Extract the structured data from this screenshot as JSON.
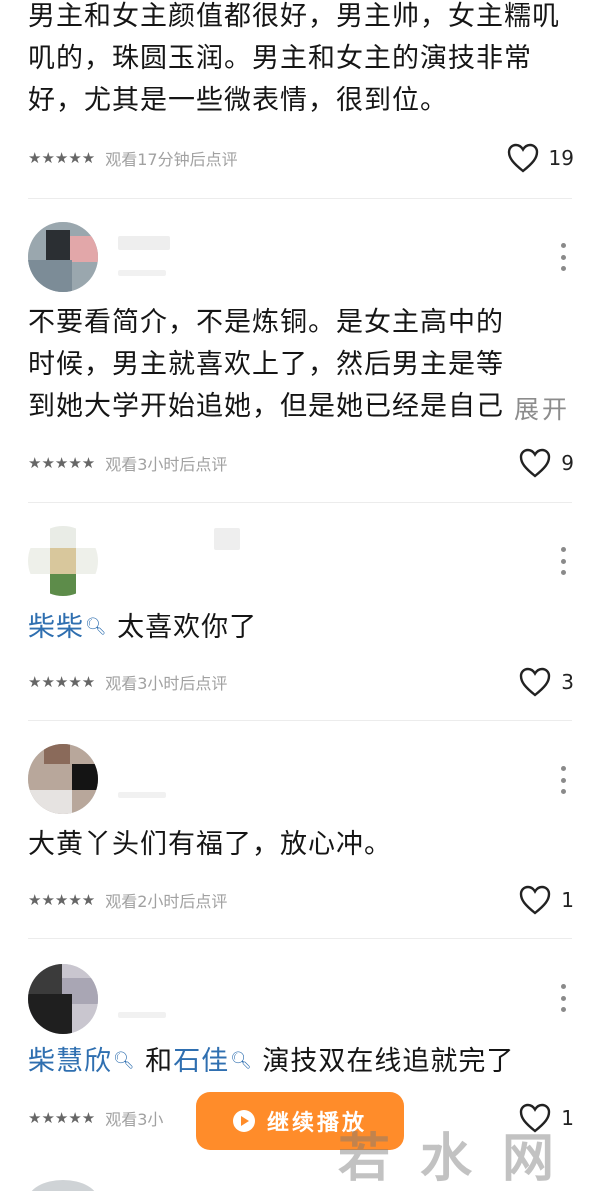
{
  "comments": [
    {
      "text": "男主和女主颜值都很好，男主帅，女主糯叽叽的，珠圆玉润。男主和女主的演技非常好，尤其是一些微表情，很到位。",
      "stars": "★★★★★",
      "watched": "观看17分钟后点评",
      "likes": "19"
    },
    {
      "text": "不要看简介，不是炼铜。是女主高中的时候，男主就喜欢上了，然后男主是等到她大学开始追她，但是她已经是自己侄子的未婚…",
      "expand": "展开",
      "stars": "★★★★★",
      "watched": "观看3小时后点评",
      "likes": "9"
    },
    {
      "mention": "柴柴",
      "text": " 太喜欢你了",
      "stars": "★★★★★",
      "watched": "观看3小时后点评",
      "likes": "3"
    },
    {
      "text": "大黄丫头们有福了，放心冲。",
      "stars": "★★★★★",
      "watched": "观看2小时后点评",
      "likes": "1"
    },
    {
      "mention1": "柴慧欣",
      "mid": " 和",
      "mention2": "石佳",
      "text": " 演技双在线追就完了",
      "stars": "★★★★★",
      "watched": "观看3小",
      "likes": "1"
    }
  ],
  "play_button": {
    "label": "继续播放"
  },
  "watermark": "若水网",
  "icons": {
    "like": "heart-outline-icon",
    "more": "vertical-dots-icon",
    "search": "magnifier-icon",
    "play": "play-circle-icon"
  },
  "colors": {
    "accent": "#ff8c2a",
    "mention": "#2f6fb0"
  }
}
